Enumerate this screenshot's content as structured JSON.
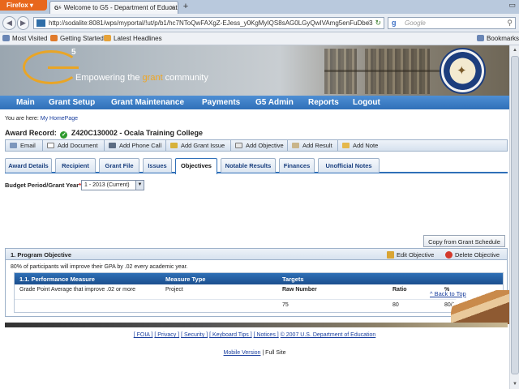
{
  "browser": {
    "app_button": "Firefox",
    "tab_title": "Welcome to G5 - Department of Educatio...",
    "url": "http://sodalite:8081/wps/myportal/!ut/p/b1/hc7NToQwFAXgZ-EJess_y0KgMyIQS8sAG0LGyQwIVAmg5enFuDbe3",
    "search_placeholder": "Google",
    "bookmarks": [
      "Most Visited",
      "Getting Started",
      "Latest Headlines"
    ],
    "bookmarks_right": "Bookmarks"
  },
  "banner": {
    "logo_sup": "5",
    "tagline_prefix": "Empowering the ",
    "tagline_highlight": "grant",
    "tagline_suffix": " community"
  },
  "main_nav": [
    "Main",
    "Grant Setup",
    "Grant Maintenance",
    "Payments",
    "G5 Admin",
    "Reports",
    "Logout"
  ],
  "breadcrumb": {
    "prefix": "You are here:",
    "link": "My HomePage"
  },
  "award": {
    "label": "Award Record:",
    "value": "Z420C130002 - Ocala Training College"
  },
  "actions": [
    "Email",
    "Add Document",
    "Add Phone Call",
    "Add Grant Issue",
    "Add Objective",
    "Add Result",
    "Add Note"
  ],
  "tabs": [
    "Award Details",
    "Recipient",
    "Grant File",
    "Issues",
    "Objectives",
    "Notable Results",
    "Finances",
    "Unofficial Notes"
  ],
  "active_tab": "Objectives",
  "budget": {
    "label": "Budget Period/Grant Year",
    "required": "*",
    "selected": "1 - 2013 (Current)"
  },
  "copy_button": "Copy from Grant Schedule",
  "objective": {
    "title": "1. Program Objective",
    "edit": "Edit Objective",
    "delete": "Delete Objective",
    "description": "80% of participants will improve their GPA by .02 every academic year.",
    "table": {
      "headers": [
        "1.1. Performance Measure",
        "Measure Type",
        "Targets"
      ],
      "measure": "Grade Point Average that improve .02 or more",
      "measure_type": "Project",
      "target_headers": [
        "Raw Number",
        "Ratio",
        "%"
      ],
      "target_values": [
        "75",
        "80",
        "80/100"
      ]
    }
  },
  "back_to_top": "^ Back to Top",
  "footer": {
    "links": [
      "[ FOIA ]",
      "[ Privacy ]",
      "[ Security ]",
      "[ Keyboard Tips ]",
      "[ Notices ]",
      "© 2007 U.S. Department of Education"
    ],
    "mobile_link": "Mobile Version",
    "separator": " | ",
    "full_site": "Full Site"
  },
  "colors": {
    "nav_blue": "#2f6fb8",
    "accent_orange": "#e9a526",
    "link": "#1a3f9e"
  }
}
